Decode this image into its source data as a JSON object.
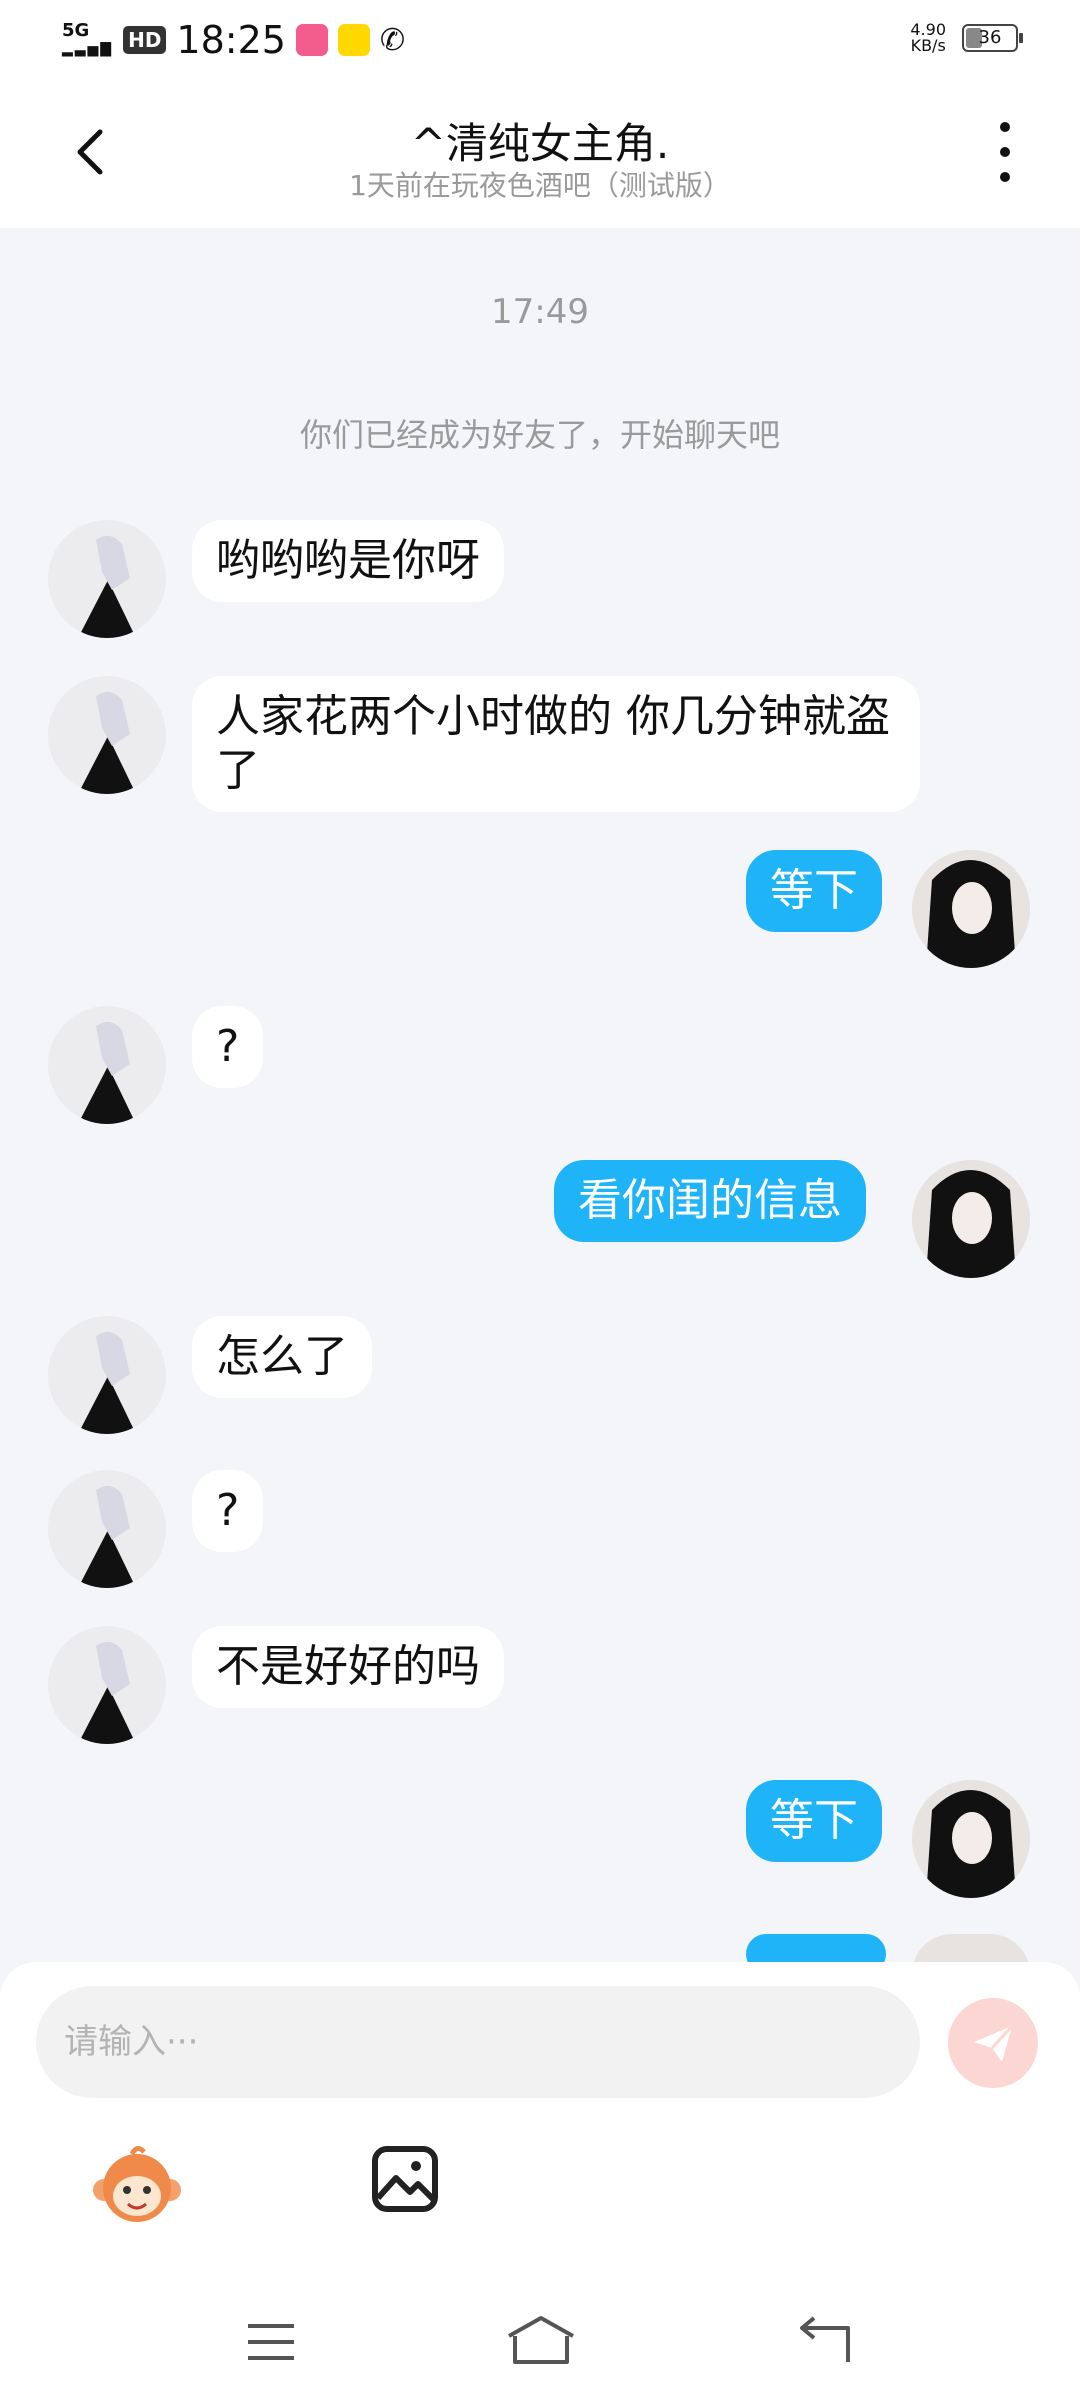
{
  "status_bar": {
    "signal": "5G",
    "hd": "HD",
    "time": "18:25",
    "app_icon_1": "bilibili",
    "app_icon_2": "快看",
    "net_speed": "4.90",
    "net_unit": "KB/s",
    "battery": "36",
    "battery_level_fraction": 0.36
  },
  "header": {
    "title": "^清纯女主角.",
    "subtitle": "1天前在玩夜色酒吧（测试版）"
  },
  "chat": {
    "timestamp": "17:49",
    "system_message": "你们已经成为好友了，开始聊天吧",
    "messages": [
      {
        "side": "in",
        "text": "哟哟哟是你呀"
      },
      {
        "side": "in",
        "text": "人家花两个小时做的 你几分钟就盗了"
      },
      {
        "side": "out",
        "text": "等下"
      },
      {
        "side": "in",
        "text": "?"
      },
      {
        "side": "out",
        "text": "看你闺的信息"
      },
      {
        "side": "in",
        "text": "怎么了"
      },
      {
        "side": "in",
        "text": "?"
      },
      {
        "side": "in",
        "text": "不是好好的吗"
      },
      {
        "side": "out",
        "text": "等下"
      }
    ]
  },
  "input": {
    "placeholder": "请输入···",
    "send_icon": "paper-plane-icon",
    "emoji_icon": "monkey-emoji-icon",
    "image_icon": "image-icon"
  },
  "colors": {
    "outgoing_bubble": "#1fb3f7",
    "incoming_bubble": "#ffffff",
    "chat_background": "#f3f5f8",
    "send_button": "#fcd6d3"
  }
}
